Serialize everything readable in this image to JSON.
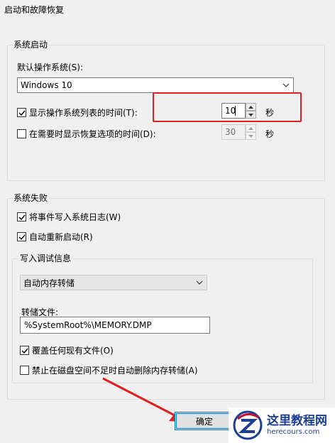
{
  "window": {
    "title": "启动和故障恢复"
  },
  "startup": {
    "group_label": "系统启动",
    "default_os_label": "默认操作系统(S):",
    "default_os_value": "Windows 10",
    "show_list": {
      "label": "显示操作系统列表的时间(T):",
      "checked": true,
      "value": "10",
      "unit": "秒"
    },
    "show_recovery": {
      "label": "在需要时显示恢复选项的时间(D):",
      "checked": false,
      "value": "30",
      "unit": "秒"
    }
  },
  "failure": {
    "group_label": "系统失败",
    "write_event": {
      "label": "将事件写入系统日志(W)",
      "checked": true
    },
    "auto_restart": {
      "label": "自动重新启动(R)",
      "checked": true
    },
    "debug": {
      "group_label": "写入调试信息",
      "dump_type": "自动内存转储",
      "dump_file_label": "转储文件:",
      "dump_file_value": "%SystemRoot%\\MEMORY.DMP",
      "overwrite": {
        "label": "覆盖任何现有文件(O)",
        "checked": true
      },
      "disable_auto_delete": {
        "label": "禁止在磁盘空间不足时自动删除内存转储(A)",
        "checked": false
      }
    }
  },
  "buttons": {
    "ok": "确定"
  },
  "watermark": {
    "name": "这里教程网",
    "url": "herecours.com"
  },
  "colors": {
    "highlight": "#e02020",
    "accent": "#0078d7",
    "watermark_red": "#c8102e",
    "watermark_blue": "#1c3f94"
  }
}
